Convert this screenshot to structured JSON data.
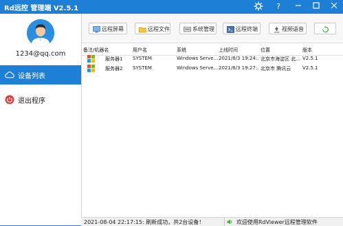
{
  "app": {
    "title": "Rd远控  管理端 V2.5.1"
  },
  "user": {
    "email": "1234@qq.com"
  },
  "sidebar": {
    "items": [
      {
        "label": "设备列表",
        "icon": "cloud-icon"
      },
      {
        "label": "退出程序",
        "icon": "power-icon"
      }
    ]
  },
  "toolbar": {
    "buttons": [
      {
        "label": "远程屏幕",
        "icon": "monitor-icon"
      },
      {
        "label": "远程文件",
        "icon": "folder-icon"
      },
      {
        "label": "系统管理",
        "icon": "system-icon"
      },
      {
        "label": "远程终端",
        "icon": "terminal-icon"
      },
      {
        "label": "视频语音",
        "icon": "upload-icon"
      },
      {
        "label": "",
        "icon": "refresh-icon"
      }
    ]
  },
  "table": {
    "columns": [
      "备注/机器名",
      "用户名",
      "系统",
      "上线时间",
      "位置",
      "版本"
    ],
    "rows": [
      [
        "服务器1",
        "SYSTEM",
        "Windows Serve...",
        "2021/8/3 19:24:...",
        "北京市海淀区 北...",
        "V2.5.1"
      ],
      [
        "服务器2",
        "SYSTEM",
        "Windows Serve...",
        "2021/8/3 19:27:...",
        "北京市 腾讯云",
        "V2.5.1"
      ]
    ]
  },
  "status": {
    "left": "2021-08-04 22:17:15:  刷新成功，共2台设备！",
    "right": "欢迎使用RdViewer远程管理软件"
  },
  "colors": {
    "accent": "#1e7fd6",
    "danger": "#e53935",
    "speaker": "#3cb043"
  }
}
